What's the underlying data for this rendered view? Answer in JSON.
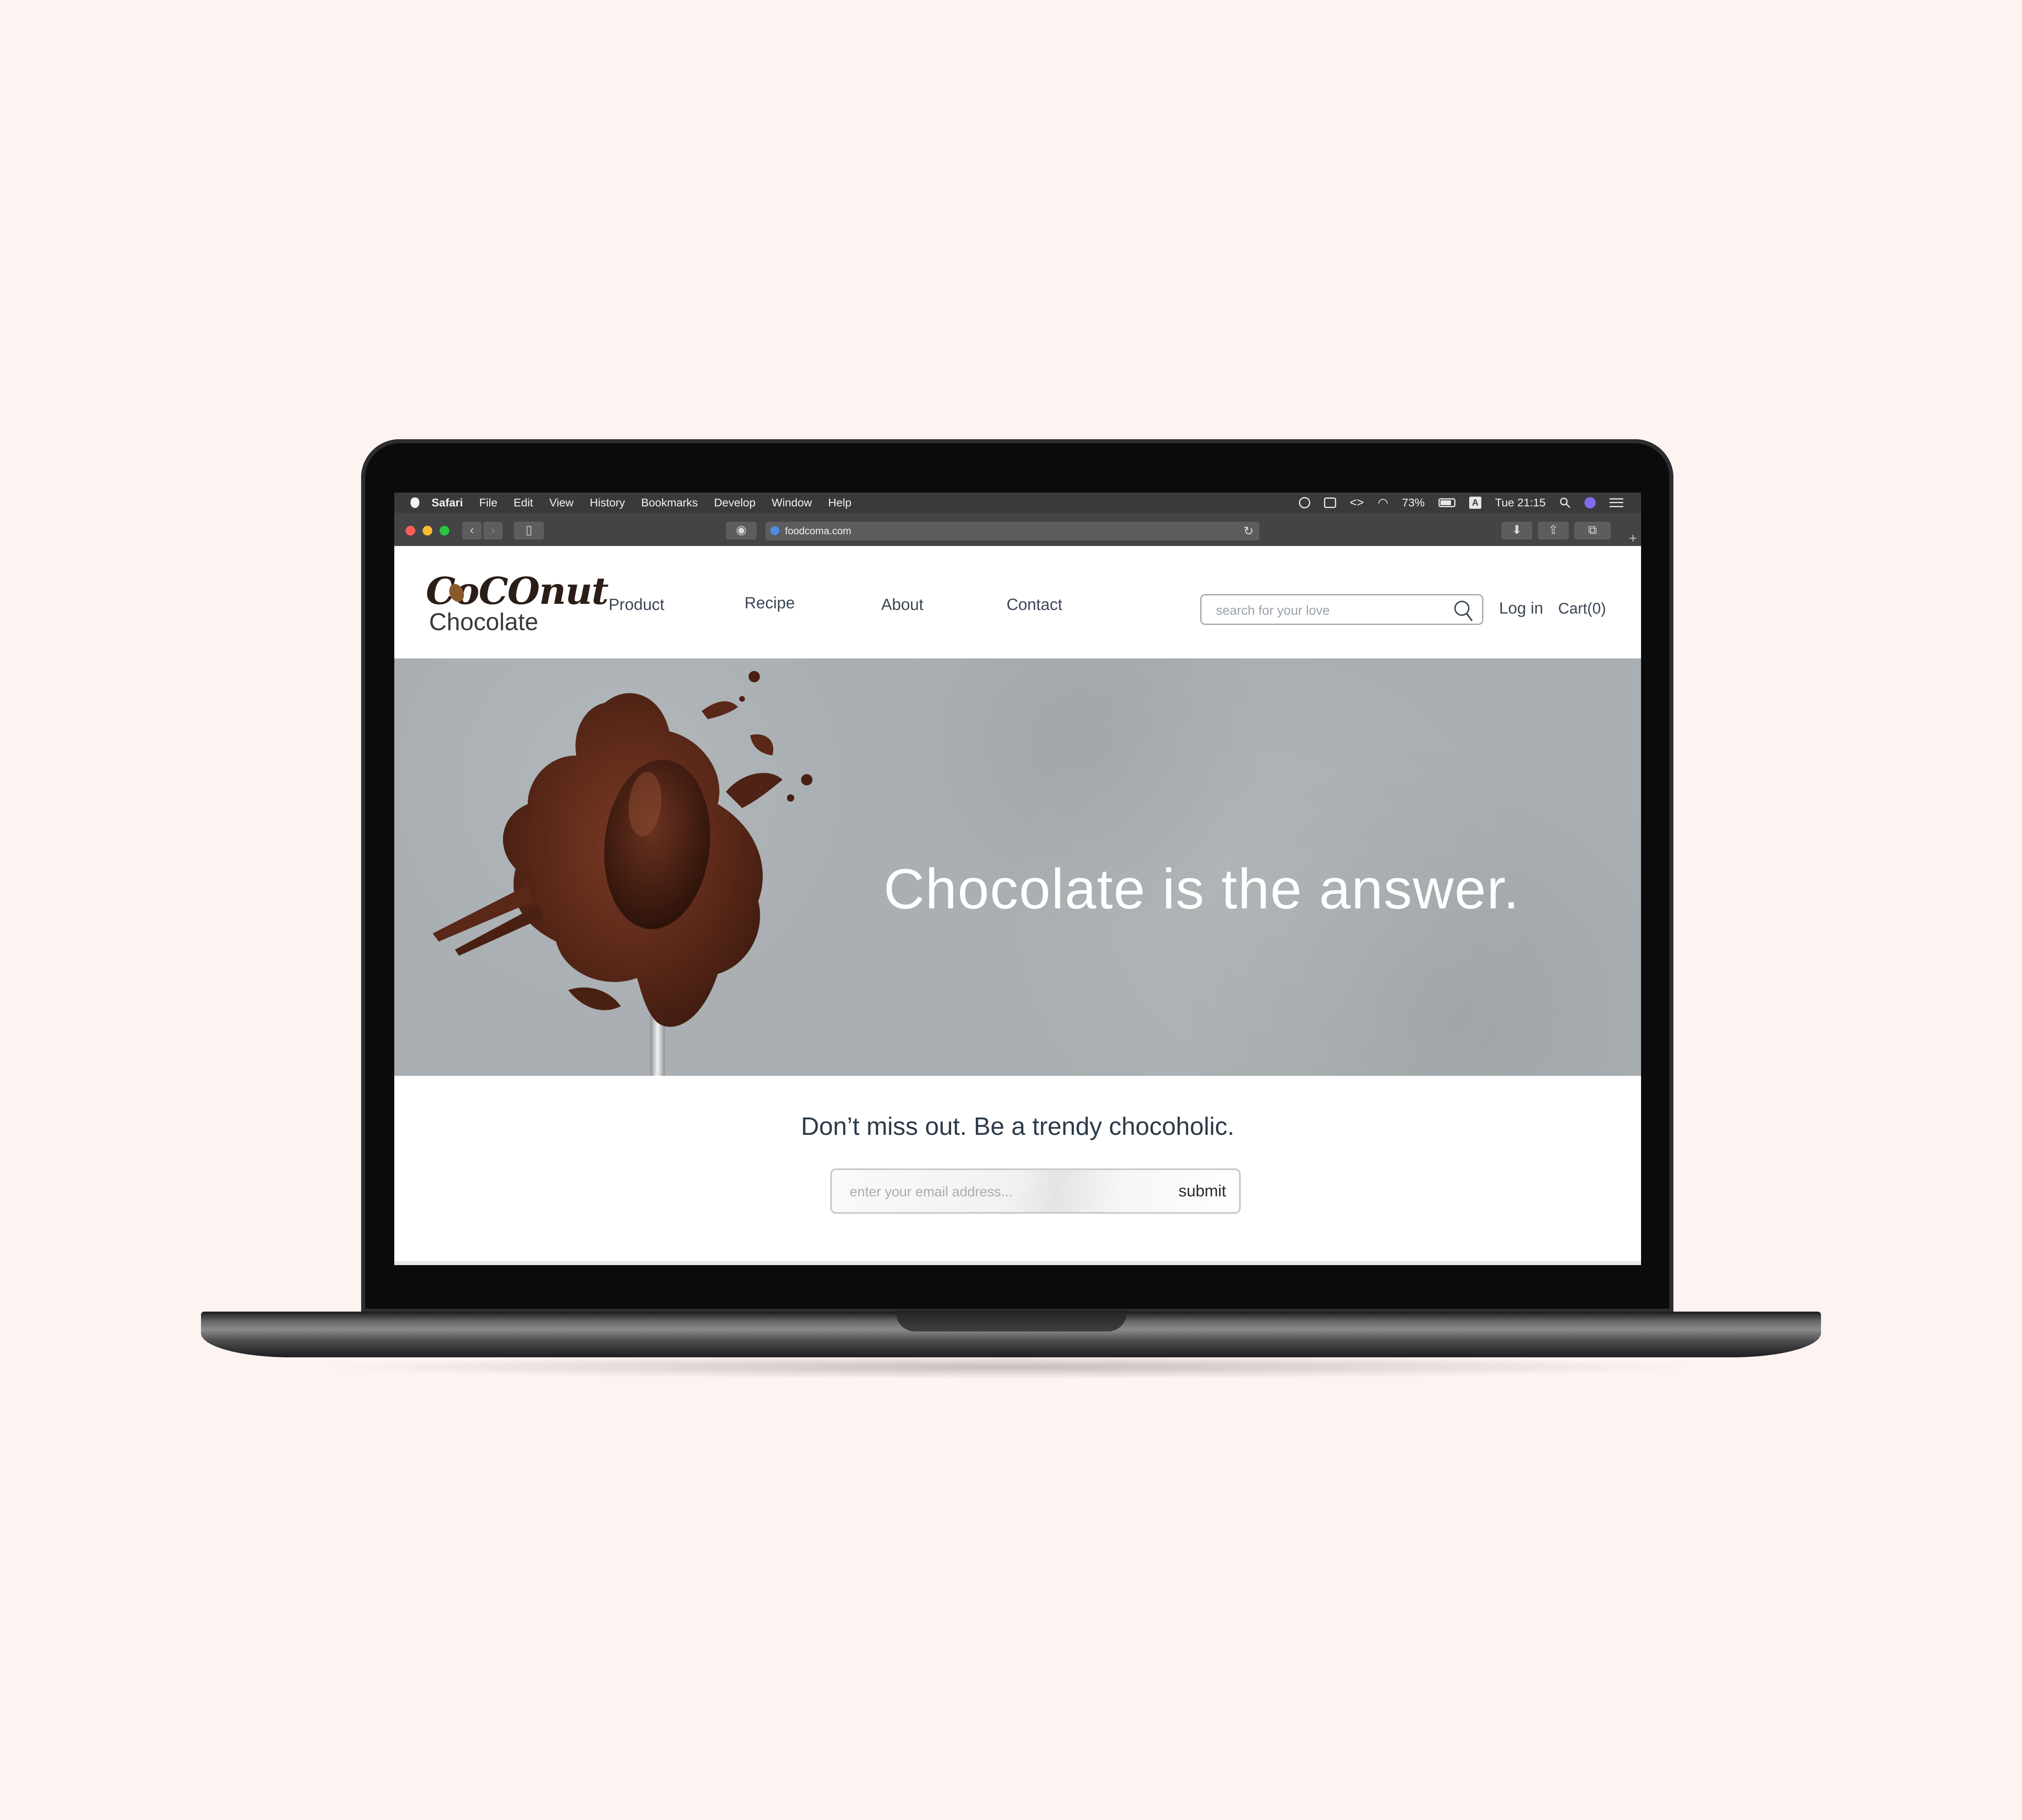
{
  "menubar": {
    "app": "Safari",
    "items": [
      "File",
      "Edit",
      "View",
      "History",
      "Bookmarks",
      "Develop",
      "Window",
      "Help"
    ],
    "battery": "73%",
    "clock": "Tue 21:15",
    "input_badge": "A"
  },
  "browser": {
    "url": "foodcoma.com",
    "traffic_lights": [
      "#ff5f57",
      "#febc2e",
      "#28c840"
    ]
  },
  "site": {
    "logo_top": "CoCOnut",
    "logo_bottom": "Chocolate",
    "nav": [
      "Product",
      "Recipe",
      "About",
      "Contact"
    ],
    "search_placeholder": "search for your love",
    "login": "Log in",
    "cart": "Cart(0)"
  },
  "hero": {
    "title": "Chocolate is the answer."
  },
  "newsletter": {
    "title": "Don’t miss out. Be a trendy chocoholic.",
    "email_placeholder": "enter your email address...",
    "submit": "submit"
  }
}
